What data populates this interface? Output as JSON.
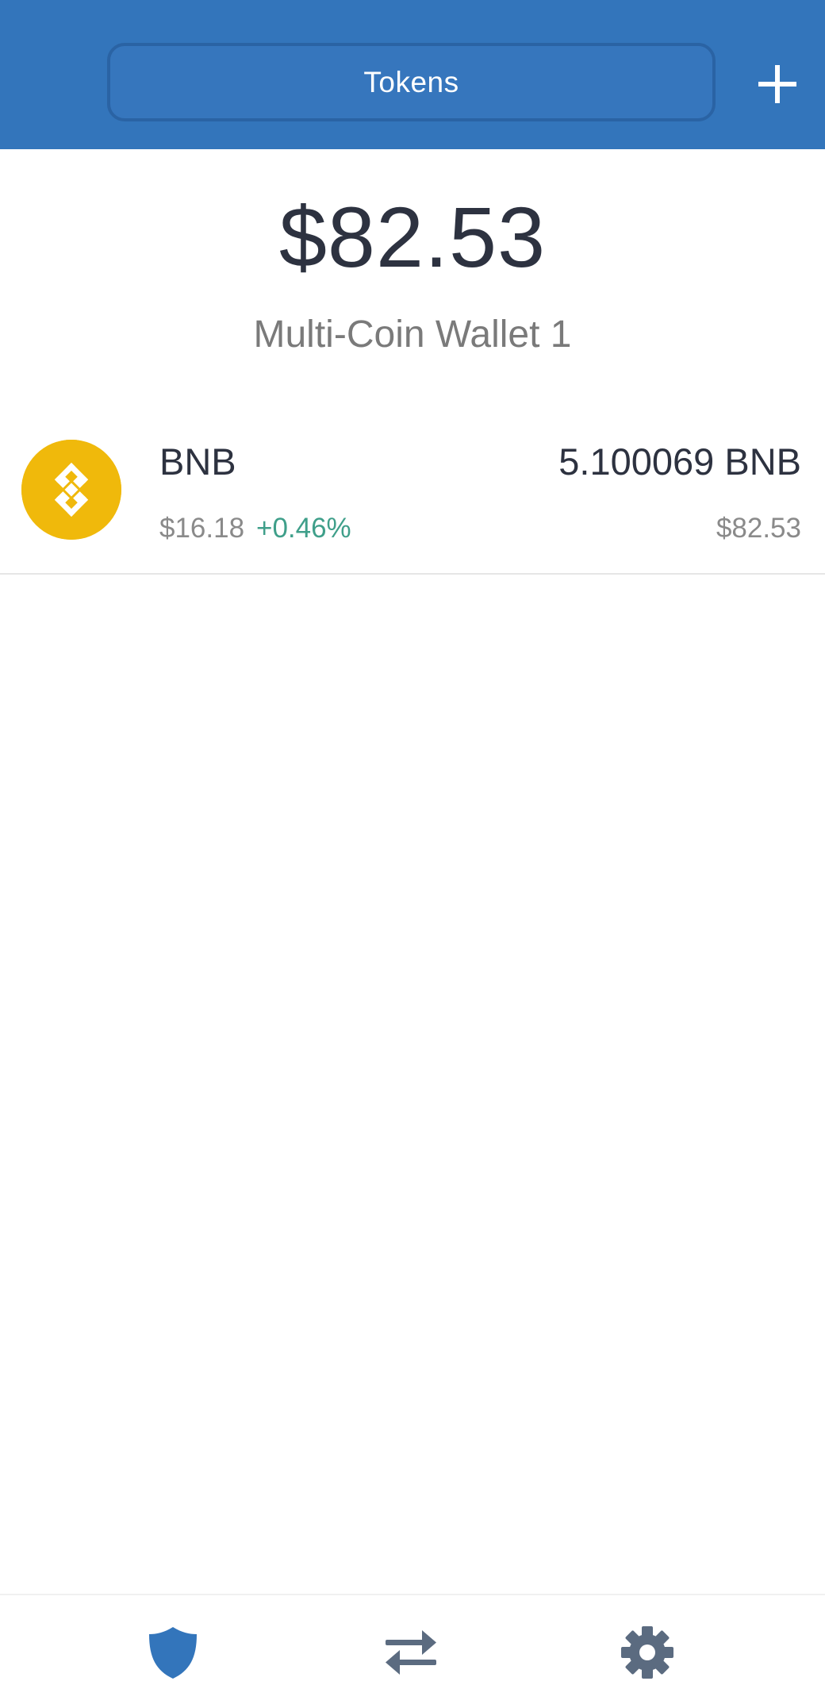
{
  "header": {
    "tab_label": "Tokens",
    "add_icon": "plus-icon",
    "background_color": "#3375bb"
  },
  "wallet": {
    "total_balance": "$82.53",
    "name": "Multi-Coin Wallet 1"
  },
  "tokens": [
    {
      "icon": "bnb-coin-icon",
      "symbol": "BNB",
      "price": "$16.18",
      "change": "+0.46%",
      "amount": "5.100069 BNB",
      "value": "$82.53",
      "change_color": "#3f9f8a",
      "logo_color": "#f0b90b"
    }
  ],
  "bottom_nav": {
    "items": [
      {
        "icon": "shield-icon",
        "active": true,
        "color": "#3375bb"
      },
      {
        "icon": "swap-arrows-icon",
        "active": false,
        "color": "#5b6b80"
      },
      {
        "icon": "gear-icon",
        "active": false,
        "color": "#5b6b80"
      }
    ]
  }
}
